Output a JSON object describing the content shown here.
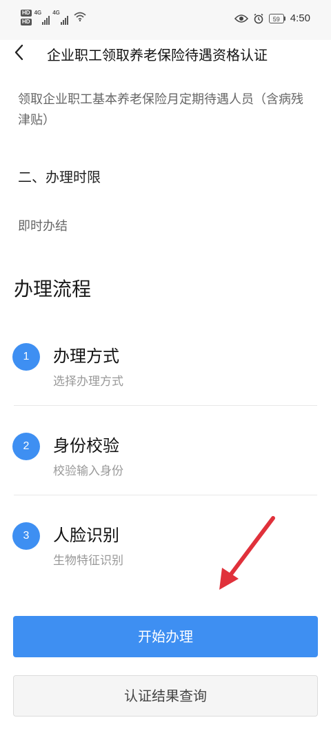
{
  "status_bar": {
    "hd_badges": [
      "HD",
      "HD"
    ],
    "network_1": "4G",
    "network_2": "4G",
    "battery_level": "59",
    "time": "4:50",
    "icons": [
      "hd-icon",
      "signal-icon",
      "wifi-icon",
      "eye-icon",
      "alarm-icon",
      "battery-icon"
    ]
  },
  "header": {
    "back_icon": "chevron-left-icon",
    "title": "企业职工领取养老保险待遇资格认证"
  },
  "content": {
    "description": "领取企业职工基本养老保险月定期待遇人员（含病残津贴）",
    "section_heading": "二、办理时限",
    "section_body": "即时办结"
  },
  "process": {
    "title": "办理流程",
    "steps": [
      {
        "number": "1",
        "title": "办理方式",
        "subtitle": "选择办理方式"
      },
      {
        "number": "2",
        "title": "身份校验",
        "subtitle": "校验输入身份"
      },
      {
        "number": "3",
        "title": "人脸识别",
        "subtitle": "生物特征识别"
      }
    ]
  },
  "annotation": {
    "arrow_icon": "red-arrow-icon",
    "arrow_color": "#e0313b"
  },
  "actions": {
    "primary_label": "开始办理",
    "secondary_label": "认证结果查询"
  },
  "colors": {
    "accent": "#3e8ff2",
    "secondary_bg": "#f5f5f5"
  }
}
